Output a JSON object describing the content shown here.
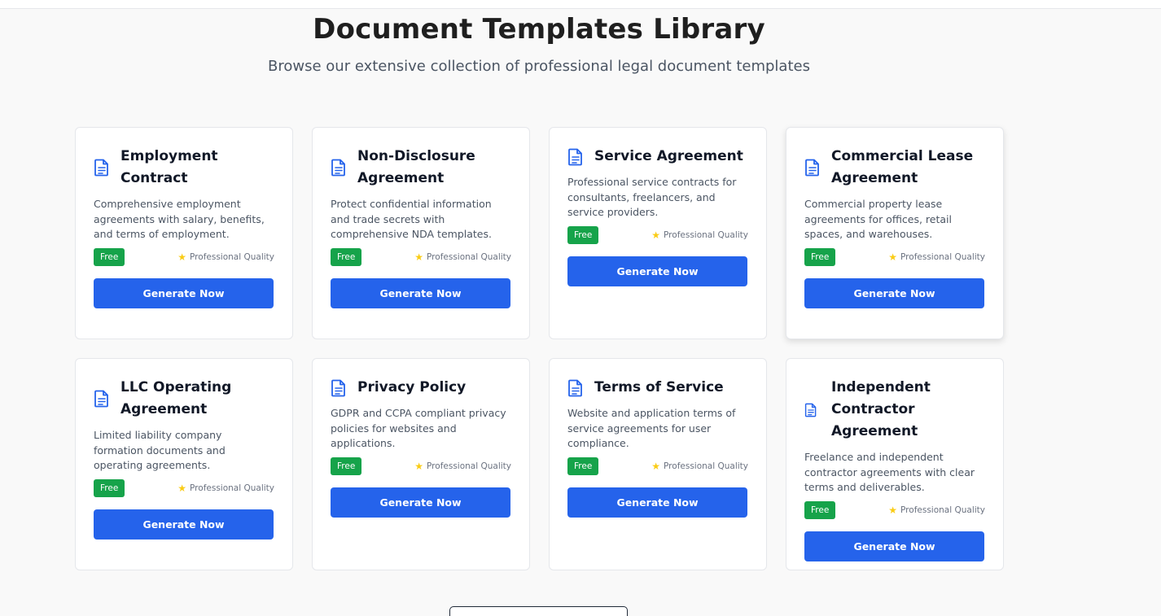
{
  "header": {
    "title": "Document Templates Library",
    "subtitle": "Browse our extensive collection of professional legal document templates"
  },
  "colors": {
    "primary_button": "#2563eb",
    "free_badge": "#16a34a",
    "star": "#facc15",
    "icon": "#2563eb"
  },
  "templates": [
    {
      "title": "Employment Contract",
      "description": "Comprehensive employment agreements with salary, benefits, and terms of employment.",
      "badge": "Free",
      "quality": "Professional Quality",
      "button": "Generate Now",
      "icon": "document-icon"
    },
    {
      "title": "Non-Disclosure Agreement",
      "description": "Protect confidential information and trade secrets with comprehensive NDA templates.",
      "badge": "Free",
      "quality": "Professional Quality",
      "button": "Generate Now",
      "icon": "document-icon"
    },
    {
      "title": "Service Agreement",
      "description": "Professional service contracts for consultants, freelancers, and service providers.",
      "badge": "Free",
      "quality": "Professional Quality",
      "button": "Generate Now",
      "icon": "document-icon"
    },
    {
      "title": "Commercial Lease Agreement",
      "description": "Commercial property lease agreements for offices, retail spaces, and warehouses.",
      "badge": "Free",
      "quality": "Professional Quality",
      "button": "Generate Now",
      "icon": "document-icon"
    },
    {
      "title": "LLC Operating Agreement",
      "description": "Limited liability company formation documents and operating agreements.",
      "badge": "Free",
      "quality": "Professional Quality",
      "button": "Generate Now",
      "icon": "document-icon"
    },
    {
      "title": "Privacy Policy",
      "description": "GDPR and CCPA compliant privacy policies for websites and applications.",
      "badge": "Free",
      "quality": "Professional Quality",
      "button": "Generate Now",
      "icon": "document-icon"
    },
    {
      "title": "Terms of Service",
      "description": "Website and application terms of service agreements for user compliance.",
      "badge": "Free",
      "quality": "Professional Quality",
      "button": "Generate Now",
      "icon": "document-icon"
    },
    {
      "title": "Independent Contractor Agreement",
      "description": "Freelance and independent contractor agreements with clear terms and deliverables.",
      "badge": "Free",
      "quality": "Professional Quality",
      "button": "Generate Now",
      "icon": "document-icon"
    }
  ]
}
